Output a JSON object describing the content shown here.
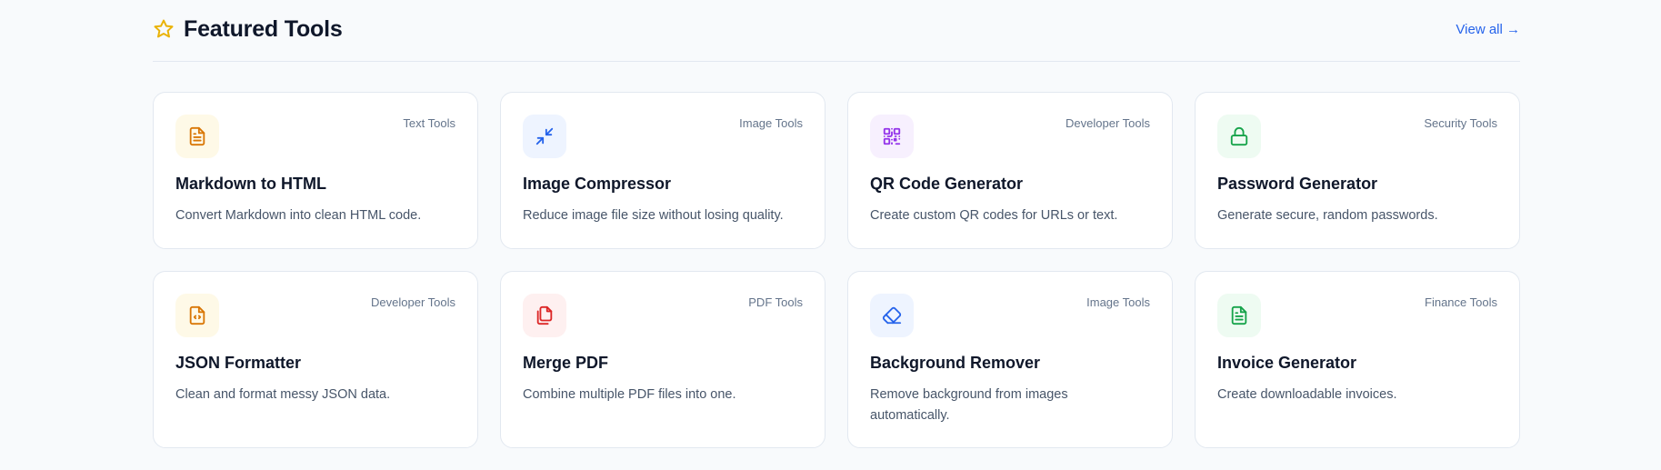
{
  "section": {
    "title": "Featured Tools",
    "view_all": "View all →"
  },
  "tools": [
    {
      "name": "Markdown to HTML",
      "category": "Text Tools",
      "description": "Convert Markdown into clean HTML code.",
      "icon": "document-icon",
      "icon_color": "#d97706",
      "icon_bg": "#fef9e7"
    },
    {
      "name": "Image Compressor",
      "category": "Image Tools",
      "description": "Reduce image file size without losing quality.",
      "icon": "compress-arrows-icon",
      "icon_color": "#2563eb",
      "icon_bg": "#eef4ff"
    },
    {
      "name": "QR Code Generator",
      "category": "Developer Tools",
      "description": "Create custom QR codes for URLs or text.",
      "icon": "qr-code-icon",
      "icon_color": "#9333ea",
      "icon_bg": "#f7f0fe"
    },
    {
      "name": "Password Generator",
      "category": "Security Tools",
      "description": "Generate secure, random passwords.",
      "icon": "lock-icon",
      "icon_color": "#16a34a",
      "icon_bg": "#eefbf2"
    },
    {
      "name": "JSON Formatter",
      "category": "Developer Tools",
      "description": "Clean and format messy JSON data.",
      "icon": "code-file-icon",
      "icon_color": "#d97706",
      "icon_bg": "#fef9e7"
    },
    {
      "name": "Merge PDF",
      "category": "PDF Tools",
      "description": "Combine multiple PDF files into one.",
      "icon": "copy-files-icon",
      "icon_color": "#dc2626",
      "icon_bg": "#fef0f0"
    },
    {
      "name": "Background Remover",
      "category": "Image Tools",
      "description": "Remove background from images automatically.",
      "icon": "eraser-icon",
      "icon_color": "#2563eb",
      "icon_bg": "#eef4ff"
    },
    {
      "name": "Invoice Generator",
      "category": "Finance Tools",
      "description": "Create downloadable invoices.",
      "icon": "spreadsheet-icon",
      "icon_color": "#16a34a",
      "icon_bg": "#eefbf2"
    }
  ],
  "colors": {
    "accent": "#2563eb",
    "star": "#eab308"
  }
}
